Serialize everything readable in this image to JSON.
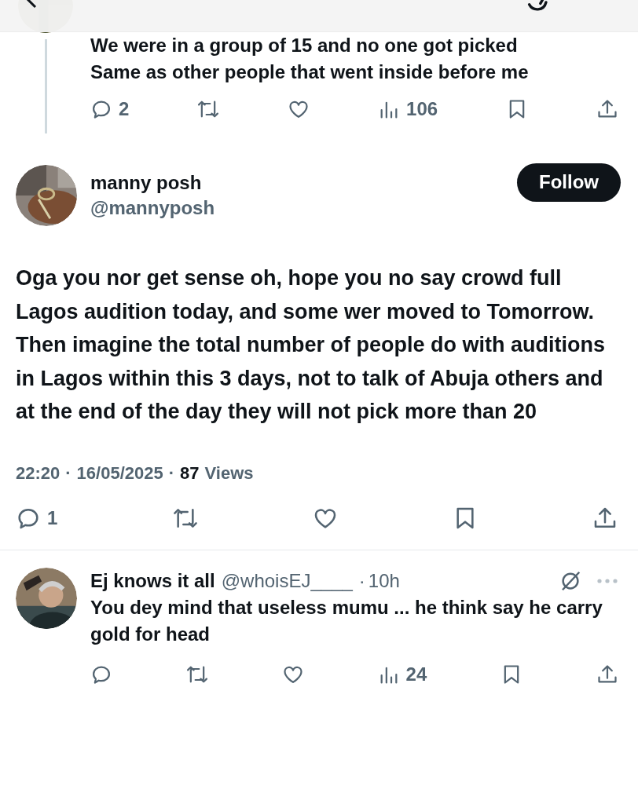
{
  "thread_reply": {
    "text": "We were in a group of 15 and no one got picked\nSame as other people that went inside before me",
    "actions": [
      {
        "kind": "reply",
        "count": "2"
      },
      {
        "kind": "repost"
      },
      {
        "kind": "like"
      },
      {
        "kind": "views",
        "count": "106"
      },
      {
        "kind": "bookmark"
      },
      {
        "kind": "share"
      }
    ]
  },
  "post": {
    "name": "manny posh",
    "handle": "@mannyposh",
    "follow_label": "Follow",
    "text": "Oga you nor get sense oh, hope you no say crowd full Lagos audition today, and some wer moved to Tomorrow. Then imagine the total number of people do with auditions in Lagos within this 3 days, not to talk of Abuja others and at the end of the day they will not pick more than 20",
    "meta": [
      {
        "text": "22:20",
        "kind": "muted"
      },
      {
        "text": "·",
        "kind": "muted"
      },
      {
        "text": "16/05/2025",
        "kind": "muted"
      },
      {
        "text": "·",
        "kind": "muted"
      },
      {
        "text": "87",
        "kind": "strong"
      },
      {
        "text": "Views",
        "kind": "muted"
      }
    ],
    "actions": [
      {
        "kind": "reply",
        "count": "1"
      },
      {
        "kind": "repost"
      },
      {
        "kind": "like"
      },
      {
        "kind": "bookmark"
      },
      {
        "kind": "share"
      }
    ]
  },
  "replies": [
    {
      "name": "Ej knows it all",
      "handle": "@whoisEJ____",
      "separator": "·",
      "time": "10h",
      "text": "You dey mind that useless mumu ... he think say he carry gold for head",
      "actions": [
        {
          "kind": "reply"
        },
        {
          "kind": "repost"
        },
        {
          "kind": "like"
        },
        {
          "kind": "views",
          "count": "24"
        },
        {
          "kind": "bookmark"
        },
        {
          "kind": "share"
        }
      ]
    }
  ]
}
